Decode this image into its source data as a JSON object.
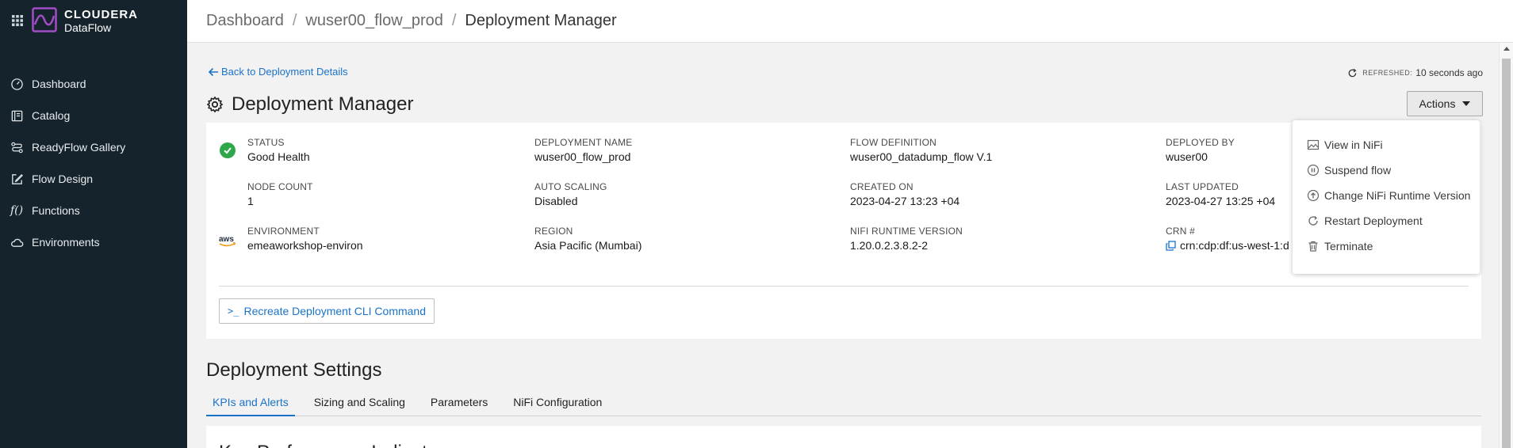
{
  "brand": {
    "name": "CLOUDERA",
    "product": "DataFlow",
    "accent": "#a24cc6"
  },
  "sidebar": {
    "items": [
      {
        "label": "Dashboard",
        "icon": "gauge-icon"
      },
      {
        "label": "Catalog",
        "icon": "book-icon"
      },
      {
        "label": "ReadyFlow Gallery",
        "icon": "flow-icon"
      },
      {
        "label": "Flow Design",
        "icon": "edit-icon"
      },
      {
        "label": "Functions",
        "icon": "function-icon",
        "glyph": "f()"
      },
      {
        "label": "Environments",
        "icon": "cloud-icon"
      }
    ]
  },
  "header": {
    "breadcrumbs": [
      "Dashboard",
      "wuser00_flow_prod",
      "Deployment Manager"
    ],
    "separator": "/"
  },
  "main": {
    "back_link": "Back to Deployment Details",
    "refreshed_label": "REFRESHED:",
    "refreshed_value": "10 seconds ago",
    "title": "Deployment Manager",
    "actions_label": "Actions",
    "cli_prompt": ">_",
    "cli_button": "Recreate Deployment CLI Command"
  },
  "details": {
    "status": {
      "label": "STATUS",
      "value": "Good Health",
      "color": "#2ea64a"
    },
    "deployment_name": {
      "label": "DEPLOYMENT NAME",
      "value": "wuser00_flow_prod"
    },
    "flow_definition": {
      "label": "FLOW DEFINITION",
      "value": "wuser00_datadump_flow V.1"
    },
    "deployed_by": {
      "label": "DEPLOYED BY",
      "value": "wuser00"
    },
    "node_count": {
      "label": "NODE COUNT",
      "value": "1"
    },
    "auto_scaling": {
      "label": "AUTO SCALING",
      "value": "Disabled"
    },
    "created_on": {
      "label": "CREATED ON",
      "value": "2023-04-27 13:23 +04"
    },
    "last_updated": {
      "label": "LAST UPDATED",
      "value": "2023-04-27 13:25 +04"
    },
    "environment": {
      "label": "ENVIRONMENT",
      "value": "emeaworkshop-environ"
    },
    "region": {
      "label": "REGION",
      "value": "Asia Pacific (Mumbai)"
    },
    "nifi_runtime": {
      "label": "NIFI RUNTIME VERSION",
      "value": "1.20.0.2.3.8.2-2"
    },
    "crn": {
      "label": "CRN #",
      "value": "crn:cdp:df:us-west-1:d"
    }
  },
  "actions_menu": [
    {
      "label": "View in NiFi",
      "icon": "image-icon"
    },
    {
      "label": "Suspend flow",
      "icon": "pause-circle-icon"
    },
    {
      "label": "Change NiFi Runtime Version",
      "icon": "upload-circle-icon"
    },
    {
      "label": "Restart Deployment",
      "icon": "restart-icon"
    },
    {
      "label": "Terminate",
      "icon": "trash-icon"
    }
  ],
  "settings": {
    "title": "Deployment Settings",
    "tabs": [
      "KPIs and Alerts",
      "Sizing and Scaling",
      "Parameters",
      "NiFi Configuration"
    ],
    "active_tab": "KPIs and Alerts",
    "kpi_title": "Key Performance Indicators"
  },
  "colors": {
    "sidebar_bg": "#15242c",
    "link": "#1a73c9",
    "page_bg": "#f2f2f2"
  }
}
